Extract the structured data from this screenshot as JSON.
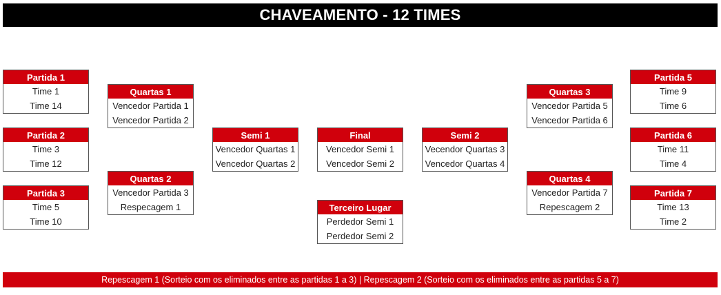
{
  "title": "CHAVEAMENTO - 12 TIMES",
  "colors": {
    "header_bg": "#000000",
    "accent": "#d0000c",
    "text": "#222222"
  },
  "matches": {
    "p1": {
      "title": "Partida 1",
      "team1": "Time 1",
      "team2": "Time 14"
    },
    "p2": {
      "title": "Partida 2",
      "team1": "Time 3",
      "team2": "Time 12"
    },
    "p3": {
      "title": "Partida 3",
      "team1": "Time 5",
      "team2": "Time 10"
    },
    "q1": {
      "title": "Quartas 1",
      "team1": "Vencedor Partida 1",
      "team2": "Vencedor Partida 2"
    },
    "q2": {
      "title": "Quartas 2",
      "team1": "Vencedor Partida 3",
      "team2": "Respecagem 1"
    },
    "s1": {
      "title": "Semi 1",
      "team1": "Vencedor Quartas 1",
      "team2": "Vencedor Quartas 2"
    },
    "final": {
      "title": "Final",
      "team1": "Vencedor Semi 1",
      "team2": "Vencedor Semi 2"
    },
    "third": {
      "title": "Terceiro Lugar",
      "team1": "Perdedor Semi 1",
      "team2": "Perdedor Semi 2"
    },
    "s2": {
      "title": "Semi 2",
      "team1": "Vecendor Quartas 3",
      "team2": "Vencedor Quartas 4"
    },
    "q3": {
      "title": "Quartas 3",
      "team1": "Vencedor Partida 5",
      "team2": "Vencedor Partida 6"
    },
    "q4": {
      "title": "Quartas 4",
      "team1": "Vencedor Partida 7",
      "team2": "Repescagem 2"
    },
    "p5": {
      "title": "Partida 5",
      "team1": "Time 9",
      "team2": "Time 6"
    },
    "p6": {
      "title": "Partida 6",
      "team1": "Time 11",
      "team2": "Time 4"
    },
    "p7": {
      "title": "Partida 7",
      "team1": "Time 13",
      "team2": "Time 2"
    }
  },
  "footer": "Repescagem 1 (Sorteio com os eliminados entre as partidas 1 a 3)  | Repescagem 2 (Sorteio com os eliminados entre as partidas 5 a 7)"
}
